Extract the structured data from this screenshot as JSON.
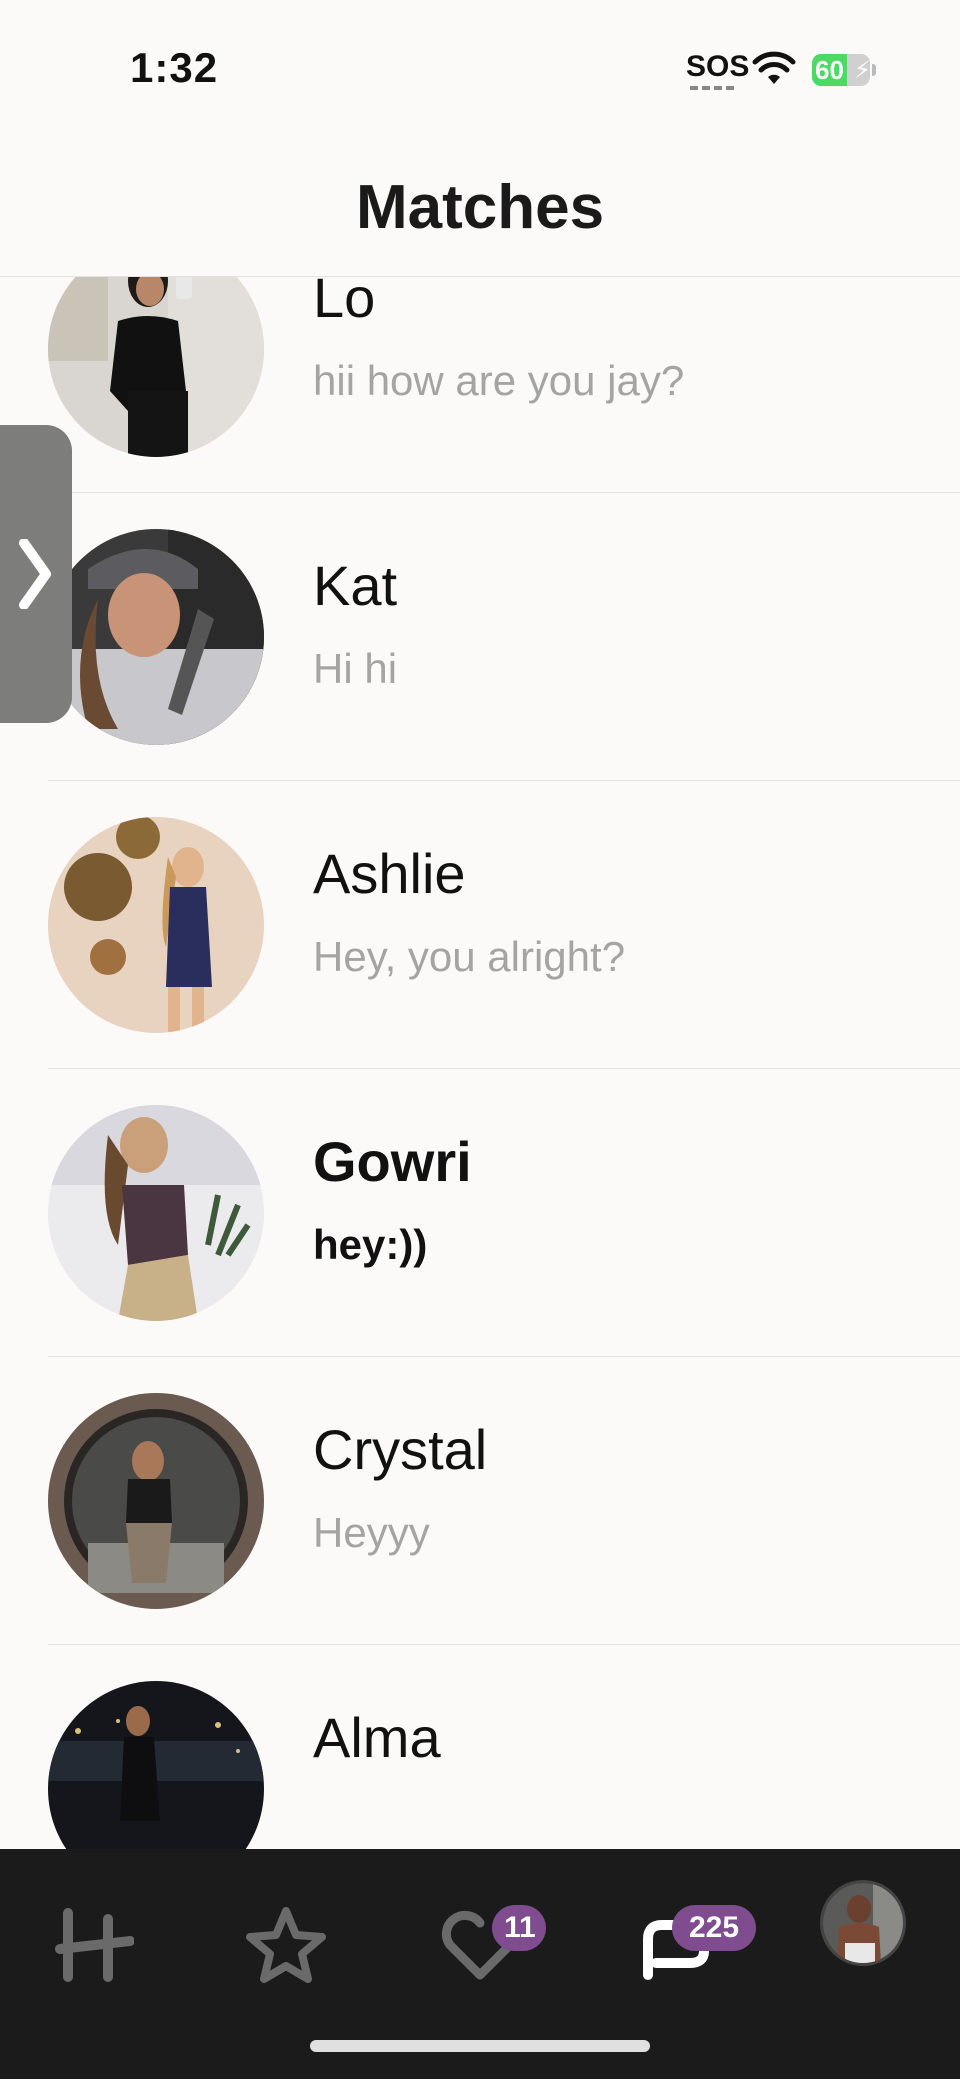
{
  "status_bar": {
    "time": "1:32",
    "sos": "SOS",
    "battery_level": "60",
    "battery_fraction": 0.6,
    "wifi_icon": "wifi-icon",
    "charging_icon": "bolt-icon"
  },
  "header": {
    "title": "Matches"
  },
  "side_handle": {
    "icon": "chevron-right-icon"
  },
  "matches": [
    {
      "name": "Lo",
      "message": "hii how are you jay?",
      "unread": false
    },
    {
      "name": "Kat",
      "message": "Hi hi",
      "unread": false
    },
    {
      "name": "Ashlie",
      "message": "Hey, you alright?",
      "unread": false
    },
    {
      "name": "Gowri",
      "message": "hey:))",
      "unread": true
    },
    {
      "name": "Crystal",
      "message": "Heyyy",
      "unread": false
    },
    {
      "name": "Alma",
      "message": "",
      "unread": false
    }
  ],
  "tab_bar": {
    "tabs": [
      {
        "icon": "hinge-logo-icon",
        "active": false
      },
      {
        "icon": "star-icon",
        "active": false
      },
      {
        "icon": "heart-check-icon",
        "badge": "11",
        "active": false
      },
      {
        "icon": "chat-icon",
        "badge": "225",
        "active": true
      },
      {
        "icon": "profile-avatar",
        "active": false
      }
    ]
  },
  "colors": {
    "background": "#fbfaf8",
    "tab_bar": "#1b1b1b",
    "badge": "#7f4c8f",
    "battery_green": "#4cd964",
    "message_grey": "#a4a4a4"
  }
}
